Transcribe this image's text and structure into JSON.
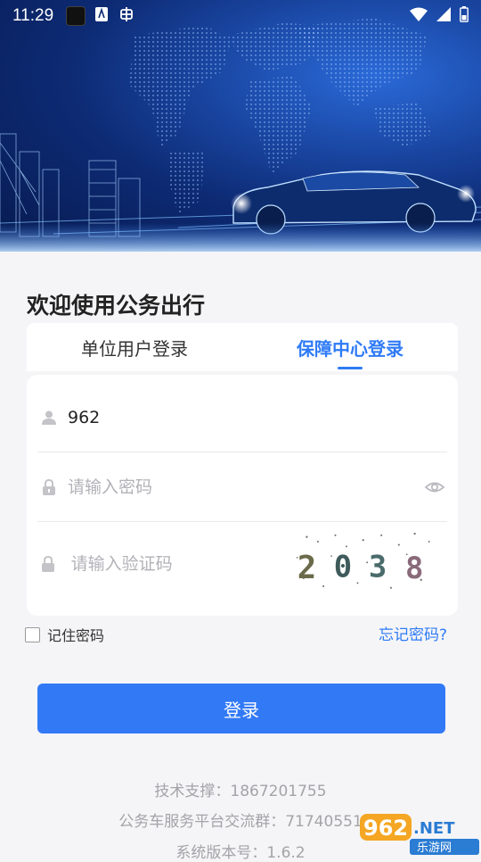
{
  "status_bar": {
    "time": "11:29"
  },
  "welcome_title": "欢迎使用公务出行",
  "tabs": [
    {
      "label": "单位用户登录",
      "active": false
    },
    {
      "label": "保障中心登录",
      "active": true
    }
  ],
  "form": {
    "username": {
      "value": "962",
      "icon": "user-icon"
    },
    "password": {
      "value": "",
      "placeholder": "请输入密码",
      "icon": "lock-icon"
    },
    "captcha": {
      "value": "",
      "placeholder": "请输入验证码",
      "icon": "lock-icon",
      "code": [
        "2",
        "0",
        "3",
        "8"
      ]
    }
  },
  "remember_label": "记住密码",
  "forgot_label": "忘记密码?",
  "login_button": "登录",
  "footer": {
    "support": "技术支撑：1867201755",
    "group": "公务车服务平台交流群：71740551",
    "version": "系统版本号：1.6.2"
  },
  "watermark": {
    "text": "962.NET",
    "sub": "乐游网"
  },
  "colors": {
    "accent": "#2f7bf6",
    "button": "#3279f6",
    "hero_dark": "#071a4f"
  }
}
